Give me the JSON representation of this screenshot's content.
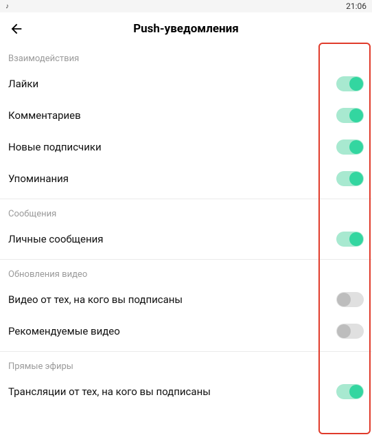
{
  "statusbar": {
    "time": "21:06"
  },
  "header": {
    "title": "Push-уведомления"
  },
  "sections": {
    "interactions": {
      "title": "Взаимодействия",
      "likes": "Лайки",
      "comments": "Комментариев",
      "followers": "Новые подписчики",
      "mentions": "Упоминания"
    },
    "messages": {
      "title": "Сообщения",
      "dm": "Личные сообщения"
    },
    "video_updates": {
      "title": "Обновления видео",
      "following": "Видео от тех, на кого вы подписаны",
      "recommended": "Рекомендуемые видео"
    },
    "live": {
      "title": "Прямые эфиры",
      "broadcasts": "Трансляции от тех, на кого вы подписаны"
    }
  },
  "toggles": {
    "likes": true,
    "comments": true,
    "followers": true,
    "mentions": true,
    "dm": true,
    "following_video": false,
    "recommended_video": false,
    "broadcasts": true
  }
}
